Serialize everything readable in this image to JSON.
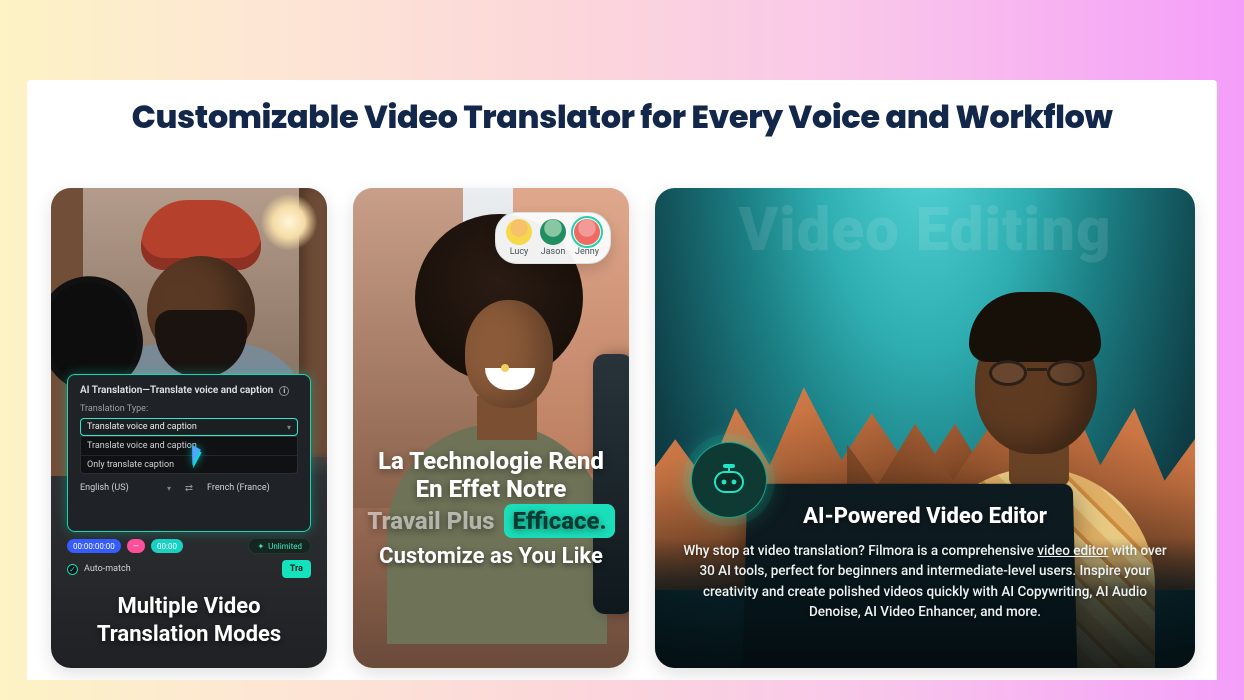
{
  "page": {
    "heading": "Customizable Video Translator for Every Voice and Workflow"
  },
  "card1": {
    "title": "Multiple Video Translation Modes",
    "ui": {
      "header": "AI Translation—Translate voice and caption",
      "type_label": "Translation Type:",
      "type_value": "Translate voice and caption",
      "options": [
        "Translate voice and caption",
        "Only translate caption"
      ],
      "src_lang": "English (US)",
      "dst_lang": "French (France)",
      "swap_glyph": "⇄",
      "chips": [
        "00:00:00:00",
        "—",
        "00:00"
      ],
      "unlimited_label": "Unlimited",
      "auto_match": "Auto-match",
      "translate_btn": "Tra"
    }
  },
  "card2": {
    "title": "Customize as You Like",
    "tagline": {
      "l1": "La Technologie Rend",
      "l2": "En Effet Notre",
      "l3a": "Travail Plus",
      "l3b": "Efficace."
    },
    "avatars": [
      {
        "name": "Lucy"
      },
      {
        "name": "Jason"
      },
      {
        "name": "Jenny"
      }
    ]
  },
  "card3": {
    "watermark": "Video Editing",
    "title": "AI-Powered Video Editor",
    "desc_a": "Why stop at video translation? Filmora is a comprehensive ",
    "desc_link": "video editor",
    "desc_b": " with over 30 AI tools, perfect for beginners and intermediate-level users. Inspire your creativity and create polished videos quickly with AI Copywriting, AI Audio Denoise, AI Video Enhancer, and more."
  }
}
